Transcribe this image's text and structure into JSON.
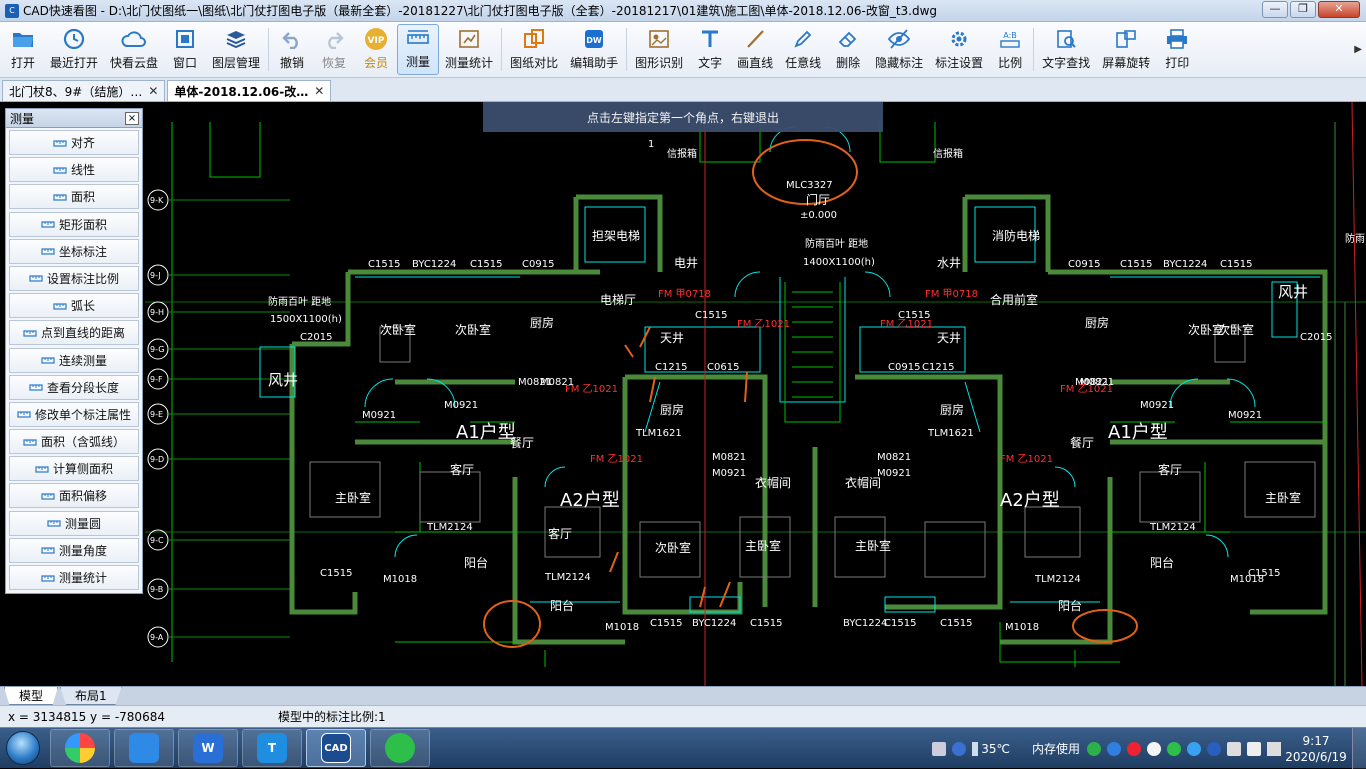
{
  "window": {
    "title": "CAD快速看图 - D:\\北门仗图纸一\\图纸\\北门仗打图电子版（最新全套）-20181227\\北门仗打图电子版（全套）-20181217\\01建筑\\施工图\\单体-2018.12.06-改窗_t3.dwg",
    "minimize": "—",
    "restore": "❐",
    "close": "✕"
  },
  "toolbar": {
    "buttons": [
      {
        "id": "open",
        "label": "打开",
        "icon": "folder-icon"
      },
      {
        "id": "recent",
        "label": "最近打开",
        "icon": "clock-icon"
      },
      {
        "id": "cloud",
        "label": "快看云盘",
        "icon": "cloud-icon"
      },
      {
        "id": "window",
        "label": "窗口",
        "icon": "window-icon"
      },
      {
        "id": "layers",
        "label": "图层管理",
        "icon": "layers-icon"
      },
      {
        "id": "undo",
        "label": "撤销",
        "icon": "undo-icon"
      },
      {
        "id": "redo",
        "label": "恢复",
        "icon": "redo-icon"
      },
      {
        "id": "vip",
        "label": "会员",
        "icon": "vip-icon"
      },
      {
        "id": "measure",
        "label": "测量",
        "icon": "ruler-icon"
      },
      {
        "id": "measure-stats",
        "label": "测量统计",
        "icon": "measure-stats-icon"
      },
      {
        "id": "compare",
        "label": "图纸对比",
        "icon": "compare-icon"
      },
      {
        "id": "edit-helper",
        "label": "编辑助手",
        "icon": "edit-helper-icon"
      },
      {
        "id": "shape-recognize",
        "label": "图形识别",
        "icon": "shape-recognize-icon"
      },
      {
        "id": "text",
        "label": "文字",
        "icon": "text-icon"
      },
      {
        "id": "line",
        "label": "画直线",
        "icon": "line-icon"
      },
      {
        "id": "freeline",
        "label": "任意线",
        "icon": "pen-icon"
      },
      {
        "id": "erase",
        "label": "删除",
        "icon": "eraser-icon"
      },
      {
        "id": "hide-mark",
        "label": "隐藏标注",
        "icon": "eye-off-icon"
      },
      {
        "id": "mark-settings",
        "label": "标注设置",
        "icon": "settings-icon"
      },
      {
        "id": "ratio",
        "label": "比例",
        "icon": "scale-icon"
      },
      {
        "id": "find-text",
        "label": "文字查找",
        "icon": "find-text-icon"
      },
      {
        "id": "rotate",
        "label": "屏幕旋转",
        "icon": "rotate-icon"
      },
      {
        "id": "print",
        "label": "打印",
        "icon": "printer-icon"
      }
    ],
    "more": "▶"
  },
  "tabs": [
    {
      "label": "北门杖8、9#（结施）…",
      "close": "✕"
    },
    {
      "label": "单体-2018.12.06-改…",
      "close": "✕"
    }
  ],
  "hint": "点击左键指定第一个角点，右键退出",
  "measure_panel": {
    "title": "测量",
    "close": "×",
    "items": [
      "对齐",
      "线性",
      "面积",
      "矩形面积",
      "坐标标注",
      "设置标注比例",
      "弧长",
      "点到直线的距离",
      "连续测量",
      "查看分段长度",
      "修改单个标注属性",
      "面积（含弧线）",
      "计算侧面积",
      "面积偏移",
      "测量圆",
      "测量角度",
      "测量统计"
    ]
  },
  "drawing": {
    "rooms": [
      {
        "t": "主卧室"
      },
      {
        "t": "客厅"
      },
      {
        "t": "次卧室"
      },
      {
        "t": "次卧室"
      },
      {
        "t": "厨房"
      },
      {
        "t": "电梯厅"
      },
      {
        "t": "天井"
      },
      {
        "t": "厨房"
      },
      {
        "t": "衣帽间"
      },
      {
        "t": "衣帽间"
      },
      {
        "t": "主卧室"
      },
      {
        "t": "客厅"
      },
      {
        "t": "次卧室"
      },
      {
        "t": "主卧室"
      },
      {
        "t": "阳台"
      },
      {
        "t": "阳台"
      },
      {
        "t": "客厅"
      },
      {
        "t": "次卧室"
      },
      {
        "t": "次卧室"
      },
      {
        "t": "厨房"
      },
      {
        "t": "合用前室"
      },
      {
        "t": "天井"
      },
      {
        "t": "厨房"
      },
      {
        "t": "阳台"
      },
      {
        "t": "主卧室"
      },
      {
        "t": "风井"
      },
      {
        "t": "风井"
      },
      {
        "t": "水井"
      },
      {
        "t": "电井"
      },
      {
        "t": "餐厅"
      },
      {
        "t": "餐厅"
      },
      {
        "t": "消防电梯"
      },
      {
        "t": "担架电梯"
      },
      {
        "t": "门厅"
      },
      {
        "t": "阳台"
      }
    ],
    "unit_labels": [
      "A1户型",
      "A2户型",
      "A2户型",
      "A1户型"
    ],
    "tags": [
      {
        "t": "C1515"
      },
      {
        "t": "BYC1224"
      },
      {
        "t": "C1515"
      },
      {
        "t": "C0915"
      },
      {
        "t": "C0915"
      },
      {
        "t": "C1515"
      },
      {
        "t": "BYC1224"
      },
      {
        "t": "C1515"
      },
      {
        "t": "M0921"
      },
      {
        "t": "M0921"
      },
      {
        "t": "M0821"
      },
      {
        "t": "M0821"
      },
      {
        "t": "M0921"
      },
      {
        "t": "M0921"
      },
      {
        "t": "TLM1621"
      },
      {
        "t": "TLM1621"
      },
      {
        "t": "M0821"
      },
      {
        "t": "M0921"
      },
      {
        "t": "M0821"
      },
      {
        "t": "M0921"
      },
      {
        "t": "TLM2124"
      },
      {
        "t": "TLM2124"
      },
      {
        "t": "TLM2124"
      },
      {
        "t": "TLM2124"
      },
      {
        "t": "C1515"
      },
      {
        "t": "BYC1224"
      },
      {
        "t": "C1515"
      },
      {
        "t": "C1515"
      },
      {
        "t": "BYC1224"
      },
      {
        "t": "C1515"
      },
      {
        "t": "C1515"
      },
      {
        "t": "C1515"
      },
      {
        "t": "C1215"
      },
      {
        "t": "C0615"
      },
      {
        "t": "C0915"
      },
      {
        "t": "C1215"
      },
      {
        "t": "C1515"
      },
      {
        "t": "C1515"
      },
      {
        "t": "MLC3327"
      },
      {
        "t": "±0.000"
      },
      {
        "t": "1400X1100(h)"
      },
      {
        "t": "1500X1100(h)"
      },
      {
        "t": "防雨百叶 距地"
      },
      {
        "t": "防雨百叶 距地"
      },
      {
        "t": "M1018"
      },
      {
        "t": "M1018"
      },
      {
        "t": "M1018"
      },
      {
        "t": "M1018"
      },
      {
        "t": "C2015"
      },
      {
        "t": "C2015"
      },
      {
        "t": "M0821"
      },
      {
        "t": "M0821"
      }
    ],
    "red_tags": [
      {
        "t": "FM 甲0718"
      },
      {
        "t": "FM 甲0718"
      },
      {
        "t": "FM 乙1021"
      },
      {
        "t": "FM 乙1021"
      },
      {
        "t": "FM 乙1021"
      },
      {
        "t": "FM 乙1021"
      },
      {
        "t": "FM 乙1021"
      },
      {
        "t": "FM 乙1021"
      }
    ],
    "grid_axes": [
      "9-K",
      "9-J",
      "9-H",
      "9-G",
      "9-F",
      "9-E",
      "9-D",
      "9-C",
      "9-B",
      "9-A"
    ],
    "other_texts": [
      "1",
      "信报箱",
      "信报箱",
      "防雨"
    ]
  },
  "layout_tabs": [
    "模型",
    "布局1"
  ],
  "status": {
    "coords": "x = 3134815  y = -780684",
    "scale": "模型中的标注比例:1"
  },
  "taskbar": {
    "apps": [
      {
        "name": "browser",
        "icon": "browser-icon"
      },
      {
        "name": "feather",
        "icon": "feather-icon"
      },
      {
        "name": "wps",
        "icon": "wps-icon",
        "text": "W"
      },
      {
        "name": "text-tool",
        "icon": "text-tool-icon",
        "text": "T"
      },
      {
        "name": "cad",
        "icon": "cad-icon",
        "text": "CAD"
      },
      {
        "name": "wechat",
        "icon": "wechat-icon"
      }
    ],
    "weather": "35℃",
    "memory": "内存使用",
    "time": "9:17",
    "date": "2020/6/19"
  },
  "colors": {
    "wall": "#4a8a3a",
    "cyan": "#00e5e5",
    "green": "#00c000",
    "red": "#ff3030",
    "orange_markup": "#e0621a",
    "white_text": "#ffffff"
  }
}
